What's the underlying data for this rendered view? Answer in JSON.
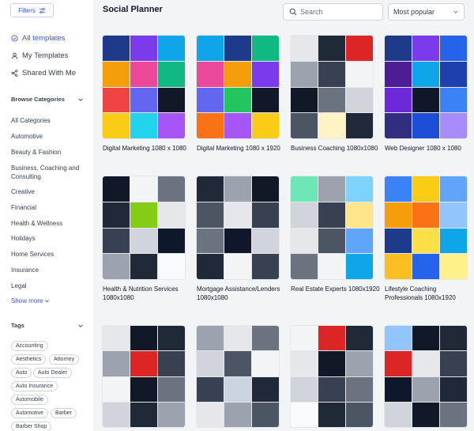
{
  "sidebar": {
    "filters_label": "Filters",
    "nav": [
      {
        "label": "All templates",
        "icon": "check-circle-icon",
        "active": true
      },
      {
        "label": "My Templates",
        "icon": "user-icon",
        "active": false
      },
      {
        "label": "Shared With Me",
        "icon": "share-icon",
        "active": false
      }
    ],
    "browse_categories_label": "Browse Categories",
    "categories": [
      "All Categories",
      "Automotive",
      "Beauty & Fashion",
      "Business, Coaching and Consulting",
      "Creative",
      "Financial",
      "Health & Wellness",
      "Holidays",
      "Home Services",
      "Insurance",
      "Legal"
    ],
    "show_more_label": "Show more",
    "tags_label": "Tags",
    "tags": [
      "Accounting",
      "Aesthetics",
      "Attorney",
      "Auto",
      "Auto Dealer",
      "Auto Insurance",
      "Automobile",
      "Automotive",
      "Barber",
      "Barber Shop"
    ]
  },
  "header": {
    "title": "Social Planner",
    "search_placeholder": "Search",
    "sort_value": "Most popular"
  },
  "templates": [
    {
      "title": "Digital Marketing 1080 x 1080",
      "palette": [
        "#1e3a8a",
        "#7c3aed",
        "#0ea5e9",
        "#f59e0b",
        "#ec4899",
        "#10b981",
        "#ef4444",
        "#6366f1",
        "#111827",
        "#facc15",
        "#22d3ee",
        "#a855f7"
      ]
    },
    {
      "title": "Digital Marketing 1080 x 1920",
      "palette": [
        "#0ea5e9",
        "#1e3a8a",
        "#10b981",
        "#ec4899",
        "#f59e0b",
        "#7c3aed",
        "#6366f1",
        "#22c55e",
        "#111827",
        "#f97316",
        "#a855f7",
        "#facc15"
      ]
    },
    {
      "title": "Business Coaching 1080x1080",
      "palette": [
        "#e5e7eb",
        "#1f2937",
        "#dc2626",
        "#9ca3af",
        "#374151",
        "#f3f4f6",
        "#111827",
        "#6b7280",
        "#d1d5db",
        "#4b5563",
        "#fef3c7",
        "#1f2937"
      ]
    },
    {
      "title": "Web Designer 1080 x 1080",
      "palette": [
        "#1e3a8a",
        "#7c3aed",
        "#2563eb",
        "#4c1d95",
        "#0ea5e9",
        "#1e40af",
        "#6d28d9",
        "#0f172a",
        "#3b82f6",
        "#312e81",
        "#1d4ed8",
        "#a78bfa"
      ]
    },
    {
      "title": "Health & Nutrition Services 1080x1080",
      "palette": [
        "#111827",
        "#f3f4f6",
        "#6b7280",
        "#1f2937",
        "#84cc16",
        "#e5e7eb",
        "#374151",
        "#d1d5db",
        "#0f172a",
        "#9ca3af",
        "#1f2937",
        "#f9fafb"
      ]
    },
    {
      "title": "Mortgage Assistance/Lenders 1080x1080",
      "palette": [
        "#1f2937",
        "#9ca3af",
        "#111827",
        "#4b5563",
        "#e5e7eb",
        "#374151",
        "#6b7280",
        "#0f172a",
        "#d1d5db",
        "#1f2937",
        "#f3f4f6",
        "#374151"
      ]
    },
    {
      "title": "Real Estate Experts 1080x1920",
      "palette": [
        "#6ee7b7",
        "#9ca3af",
        "#7dd3fc",
        "#d1d5db",
        "#374151",
        "#fde68a",
        "#e5e7eb",
        "#4b5563",
        "#60a5fa",
        "#6b7280",
        "#f3f4f6",
        "#0ea5e9"
      ]
    },
    {
      "title": "Lifestyle Coaching Professionals 1080x1920",
      "palette": [
        "#3b82f6",
        "#facc15",
        "#60a5fa",
        "#f59e0b",
        "#f97316",
        "#93c5fd",
        "#1e3a8a",
        "#fde047",
        "#0ea5e9",
        "#fbbf24",
        "#2563eb",
        "#fef08a"
      ]
    },
    {
      "title": "",
      "palette": [
        "#e5e7eb",
        "#111827",
        "#1f2937",
        "#9ca3af",
        "#dc2626",
        "#374151",
        "#f3f4f6",
        "#111827",
        "#6b7280",
        "#d1d5db",
        "#1f2937",
        "#9ca3af"
      ]
    },
    {
      "title": "",
      "palette": [
        "#9ca3af",
        "#e5e7eb",
        "#6b7280",
        "#d1d5db",
        "#4b5563",
        "#f3f4f6",
        "#374151",
        "#cbd5e1",
        "#1f2937",
        "#e5e7eb",
        "#9ca3af",
        "#4b5563"
      ]
    },
    {
      "title": "",
      "palette": [
        "#f3f4f6",
        "#dc2626",
        "#1f2937",
        "#e5e7eb",
        "#111827",
        "#9ca3af",
        "#d1d5db",
        "#374151",
        "#6b7280",
        "#f9fafb",
        "#1f2937",
        "#4b5563"
      ]
    },
    {
      "title": "",
      "palette": [
        "#93c5fd",
        "#111827",
        "#1f2937",
        "#dc2626",
        "#e5e7eb",
        "#374151",
        "#0f172a",
        "#9ca3af",
        "#1f2937",
        "#d1d5db",
        "#111827",
        "#6b7280"
      ]
    }
  ]
}
